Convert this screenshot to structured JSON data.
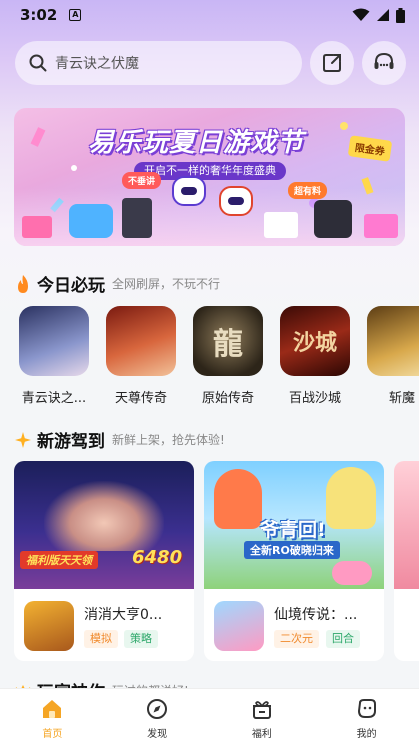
{
  "status_bar": {
    "time": "3:02",
    "notif_letter": "A"
  },
  "search": {
    "placeholder": "青云诀之伏魔"
  },
  "banner": {
    "title": "易乐玩夏日游戏节",
    "subtitle": "开启不一样的奢华年度盛典",
    "tag": "限金券",
    "labels": [
      "不垂讲",
      "超有料"
    ]
  },
  "today": {
    "title": "今日必玩",
    "subtitle": "全网刷屏，不玩不行",
    "games": [
      {
        "name": "青云诀之...",
        "color": "#7f8fbf"
      },
      {
        "name": "天尊传奇",
        "color": "#c0503a"
      },
      {
        "name": "原始传奇",
        "color": "#4f4434"
      },
      {
        "name": "百战沙城",
        "color": "#7a2216"
      },
      {
        "name": "斩魔",
        "color": "#b8882e"
      }
    ]
  },
  "new_games": {
    "title": "新游驾到",
    "subtitle": "新鲜上架，抢先体验!",
    "cards": [
      {
        "name": "消消大亨0...",
        "tags": [
          "模拟",
          "策略"
        ],
        "banner_text": "福利版天天领",
        "banner_number": "6480"
      },
      {
        "name": "仙境传说：...",
        "tags": [
          "二次元",
          "回合"
        ],
        "banner_text": "爷青回!",
        "banner_sub": "全新RO破晓归来"
      }
    ]
  },
  "next_section": {
    "title": "玩家神作",
    "subtitle": "玩过的都说好!"
  },
  "nav": {
    "items": [
      {
        "label": "首页",
        "active": true
      },
      {
        "label": "发现",
        "active": false
      },
      {
        "label": "福利",
        "active": false
      },
      {
        "label": "我的",
        "active": false
      }
    ]
  },
  "colors": {
    "accent": "#f5a524",
    "tag_orange": "#f08a2d",
    "tag_green": "#2ea86b"
  }
}
